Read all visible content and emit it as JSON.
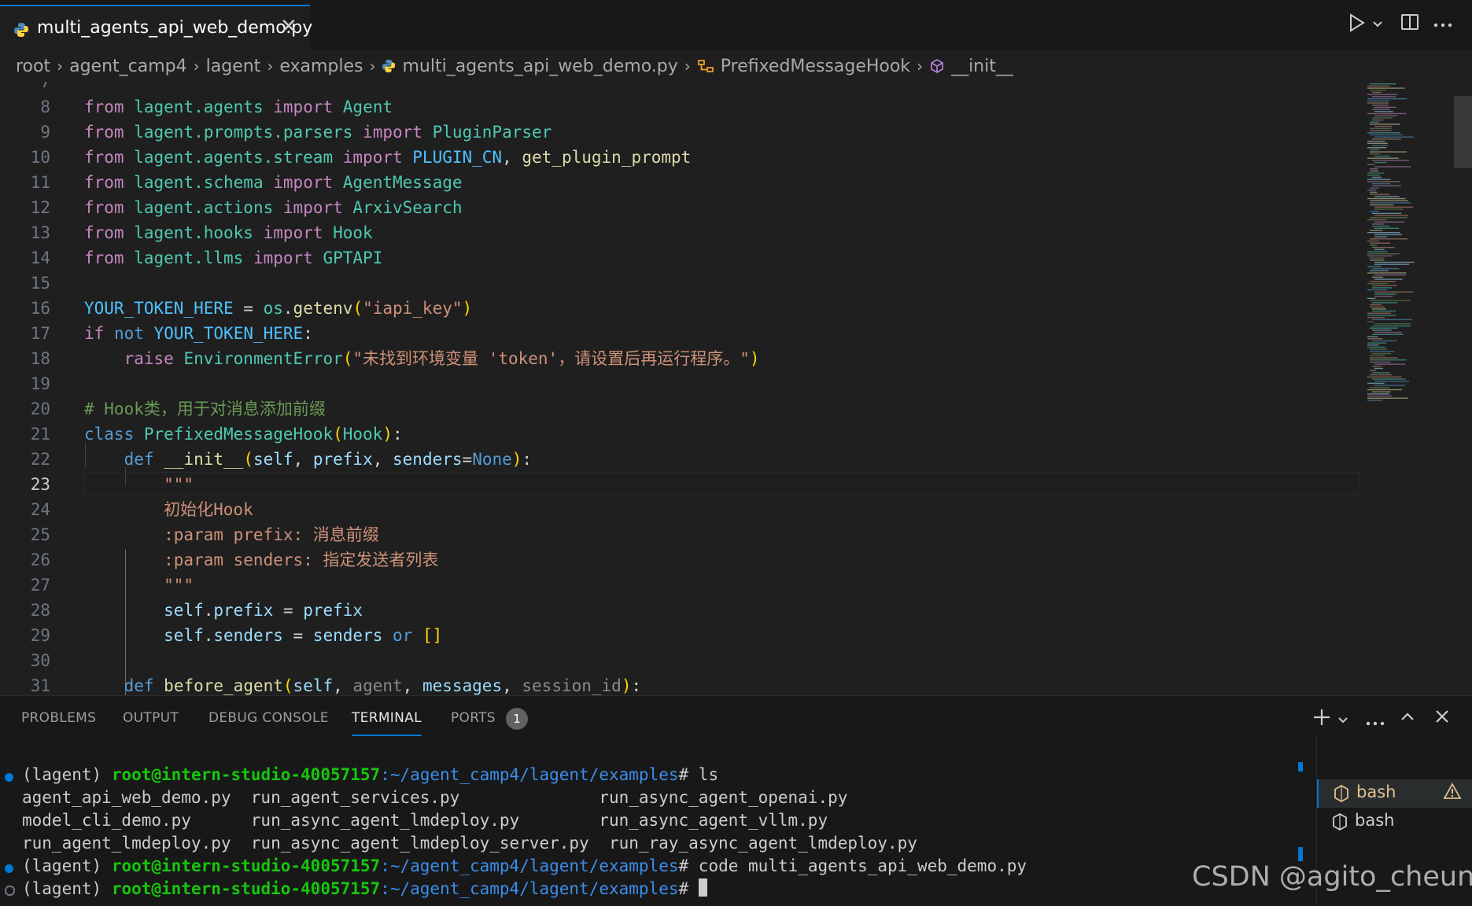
{
  "tab": {
    "filename": "multi_agents_api_web_demo.py",
    "close": "✕"
  },
  "breadcrumb": {
    "items": [
      "root",
      "agent_camp4",
      "lagent",
      "examples",
      "multi_agents_api_web_demo.py",
      "PrefixedMessageHook",
      "__init__"
    ],
    "sep": "›"
  },
  "editor": {
    "partial_line_number": "7",
    "lines": [
      {
        "n": "8",
        "text": "from lagent.agents import Agent"
      },
      {
        "n": "9",
        "text": "from lagent.prompts.parsers import PluginParser"
      },
      {
        "n": "10",
        "text": "from lagent.agents.stream import PLUGIN_CN, get_plugin_prompt"
      },
      {
        "n": "11",
        "text": "from lagent.schema import AgentMessage"
      },
      {
        "n": "12",
        "text": "from lagent.actions import ArxivSearch"
      },
      {
        "n": "13",
        "text": "from lagent.hooks import Hook"
      },
      {
        "n": "14",
        "text": "from lagent.llms import GPTAPI"
      },
      {
        "n": "15",
        "text": ""
      },
      {
        "n": "16",
        "text": "YOUR_TOKEN_HERE = os.getenv(\"iapi_key\")"
      },
      {
        "n": "17",
        "text": "if not YOUR_TOKEN_HERE:"
      },
      {
        "n": "18",
        "text": "    raise EnvironmentError(\"未找到环境变量 'token'，请设置后再运行程序。\")"
      },
      {
        "n": "19",
        "text": ""
      },
      {
        "n": "20",
        "text": "# Hook类，用于对消息添加前缀"
      },
      {
        "n": "21",
        "text": "class PrefixedMessageHook(Hook):"
      },
      {
        "n": "22",
        "text": "    def __init__(self, prefix, senders=None):"
      },
      {
        "n": "23",
        "text": "        \"\"\""
      },
      {
        "n": "24",
        "text": "        初始化Hook"
      },
      {
        "n": "25",
        "text": "        :param prefix: 消息前缀"
      },
      {
        "n": "26",
        "text": "        :param senders: 指定发送者列表"
      },
      {
        "n": "27",
        "text": "        \"\"\""
      },
      {
        "n": "28",
        "text": "        self.prefix = prefix"
      },
      {
        "n": "29",
        "text": "        self.senders = senders or []"
      },
      {
        "n": "30",
        "text": ""
      },
      {
        "n": "31",
        "text": "    def before_agent(self, agent, messages, session_id):"
      }
    ]
  },
  "panel": {
    "tabs": [
      "PROBLEMS",
      "OUTPUT",
      "DEBUG CONSOLE",
      "TERMINAL",
      "PORTS"
    ],
    "active_tab": "TERMINAL",
    "ports_count": "1"
  },
  "terminal": {
    "env": "(lagent)",
    "user_host": "root@intern-studio-40057157",
    "path": ":~/agent_camp4/lagent/examples",
    "prompt_char": "#",
    "cmd1": "ls",
    "ls_output": [
      "agent_api_web_demo.py  run_agent_services.py              run_async_agent_openai.py",
      "model_cli_demo.py      run_async_agent_lmdeploy.py        run_async_agent_vllm.py",
      "run_agent_lmdeploy.py  run_async_agent_lmdeploy_server.py  run_ray_async_agent_lmdeploy.py"
    ],
    "cmd2": "code multi_agents_api_web_demo.py",
    "sessions": [
      "bash",
      "bash"
    ]
  },
  "watermark": "CSDN @agito_cheung",
  "colors": {
    "accent": "#0078d4",
    "keyword": "#c586c0",
    "string": "#ce9178",
    "comment": "#6a9955",
    "function": "#dcdcaa",
    "class": "#4ec9b0",
    "terminal_green": "#16c60c",
    "terminal_blue": "#3b8eea"
  }
}
